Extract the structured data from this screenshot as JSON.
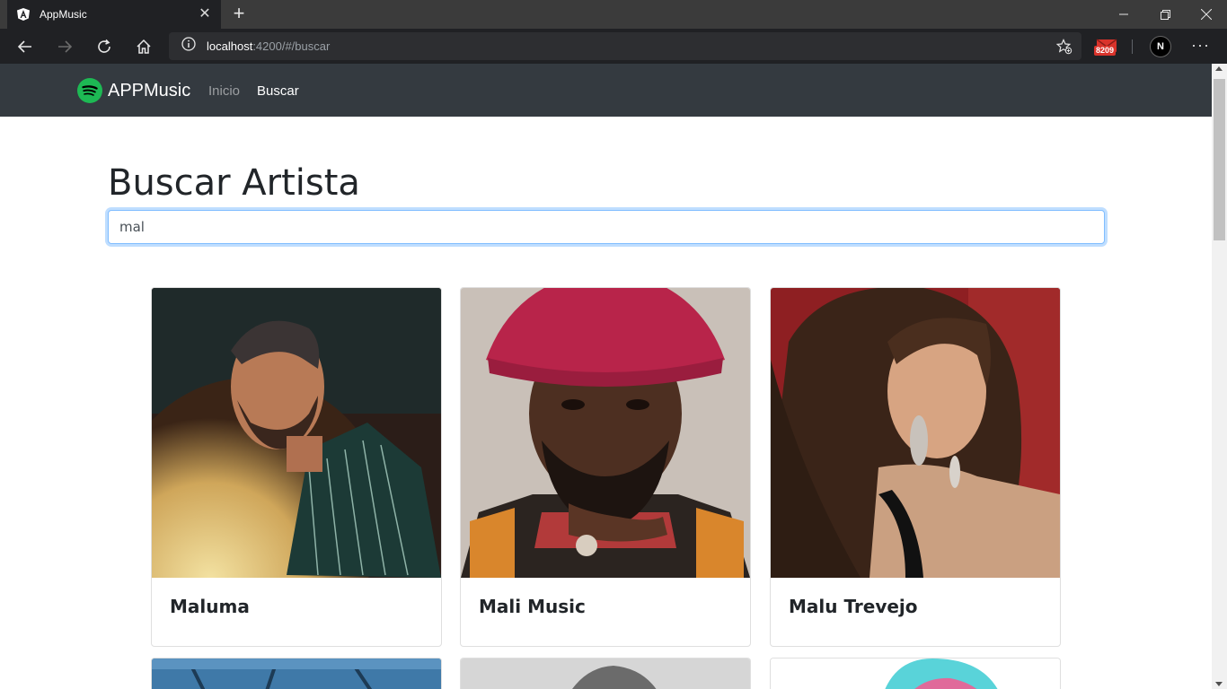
{
  "browser": {
    "tab_title": "AppMusic",
    "url_host": "localhost",
    "url_path": ":4200/#/buscar",
    "extension_badge": "8209",
    "profile_initial": "N"
  },
  "navbar": {
    "brand": "APPMusic",
    "links": [
      "Inicio",
      "Buscar"
    ],
    "active": "Buscar"
  },
  "main": {
    "title": "Buscar Artista",
    "search_value": "mal",
    "artists": [
      {
        "name": "Maluma"
      },
      {
        "name": "Mali Music"
      },
      {
        "name": "Malu Trevejo"
      }
    ]
  },
  "colors": {
    "navbar_bg": "#343a40",
    "spotify_green": "#1db954",
    "focus_border": "#80bdff"
  }
}
